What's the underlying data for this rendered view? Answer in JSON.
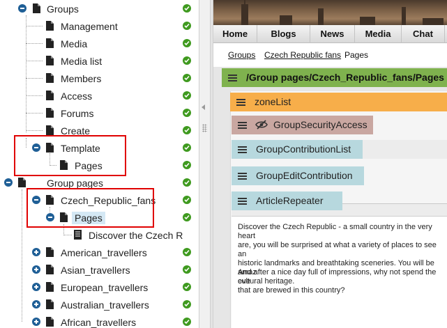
{
  "tree": {
    "items": [
      {
        "label": "Groups",
        "state": "expanded"
      },
      {
        "label": "Management"
      },
      {
        "label": "Media"
      },
      {
        "label": "Media list"
      },
      {
        "label": "Members"
      },
      {
        "label": "Access"
      },
      {
        "label": "Forums"
      },
      {
        "label": "Create"
      },
      {
        "label": "Template",
        "state": "expanded"
      },
      {
        "label": "Pages"
      },
      {
        "label": "Group pages",
        "state": "expanded"
      },
      {
        "label": "Czech_Republic_fans",
        "state": "expanded"
      },
      {
        "label": "Pages",
        "state": "expanded",
        "selected": true
      },
      {
        "label": "Discover the Czech R"
      },
      {
        "label": "American_travellers",
        "state": "collapsed"
      },
      {
        "label": "Asian_travellers",
        "state": "collapsed"
      },
      {
        "label": "European_travellers",
        "state": "collapsed"
      },
      {
        "label": "Australian_travellers",
        "state": "collapsed"
      },
      {
        "label": "African_travellers",
        "state": "collapsed"
      }
    ]
  },
  "nav": {
    "items": [
      "Home",
      "Blogs",
      "News",
      "Media",
      "Chat"
    ]
  },
  "breadcrumb": {
    "items": [
      "Groups",
      "Czech Republic fans",
      "Pages"
    ]
  },
  "zones": {
    "page_path": "/Group pages/Czech_Republic_fans/Pages -",
    "zone_list": "zoneList",
    "webparts": [
      "GroupSecurityAccess",
      "GroupContributionList",
      "GroupEditContribution",
      "ArticleRepeater"
    ]
  },
  "article": {
    "paragraph1": "Discover the Czech Republic - a small country in the very heart\nare, you will be surprised at what a variety of places to see an\nhistoric landmarks and breathtaking sceneries. You will be amaz\ncultural heritage.",
    "paragraph2": "And after a nice day full of impressions, why not spend the eve\nthat are brewed in this country?"
  },
  "colors": {
    "toggle": "#1f5f96",
    "check": "#3f9a1f",
    "highlight": "#e00000",
    "page_bar": "#7fb24e",
    "zone_bar": "#f7ae4a",
    "security_bar": "#c9a7a1",
    "webpart_bar": "#b7d8de"
  }
}
